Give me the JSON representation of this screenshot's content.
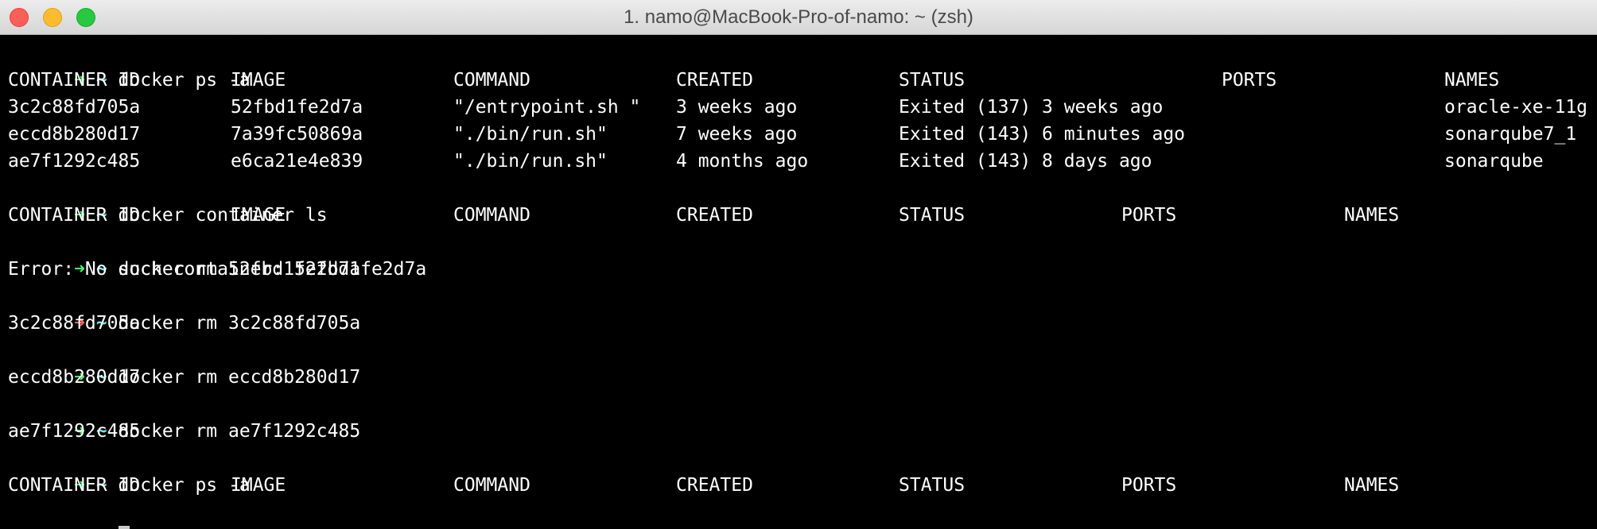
{
  "window": {
    "title": "1. namo@MacBook-Pro-of-namo: ~ (zsh)"
  },
  "prompt": {
    "arrow": "➜",
    "dir": "~"
  },
  "colors": {
    "arrow_ok": "#4ff26c",
    "arrow_error": "#ff5f5f",
    "prompt_dir": "#5ff3f3",
    "text": "#ffffff",
    "background": "#000000"
  },
  "terminal": {
    "cmd1": "docker ps -a",
    "ps1_headers": [
      "CONTAINER ID",
      "IMAGE",
      "COMMAND",
      "CREATED",
      "STATUS",
      "PORTS",
      "NAMES"
    ],
    "ps1_rows": [
      [
        "3c2c88fd705a",
        "52fbd1fe2d7a",
        "\"/entrypoint.sh \"",
        "3 weeks ago",
        "Exited (137) 3 weeks ago",
        "",
        "oracle-xe-11g"
      ],
      [
        "eccd8b280d17",
        "7a39fc50869a",
        "\"./bin/run.sh\"",
        "7 weeks ago",
        "Exited (143) 6 minutes ago",
        "",
        "sonarqube7_1"
      ],
      [
        "ae7f1292c485",
        "e6ca21e4e839",
        "\"./bin/run.sh\"",
        "4 months ago",
        "Exited (143) 8 days ago",
        "",
        "sonarqube"
      ]
    ],
    "cmd2": "docker container ls",
    "ls_headers": [
      "CONTAINER ID",
      "IMAGE",
      "COMMAND",
      "CREATED",
      "STATUS",
      "PORTS",
      "NAMES"
    ],
    "cmd3": "docker rm 52fbd1fe2d7a",
    "out3": "Error: No such container: 52fbd1fe2d7a",
    "cmd4": "docker rm 3c2c88fd705a",
    "out4": "3c2c88fd705a",
    "cmd5": "docker rm eccd8b280d17",
    "out5": "eccd8b280d17",
    "cmd6": "docker rm ae7f1292c485",
    "out6": "ae7f1292c485",
    "cmd7": "docker ps -a",
    "ps2_headers": [
      "CONTAINER ID",
      "IMAGE",
      "COMMAND",
      "CREATED",
      "STATUS",
      "PORTS",
      "NAMES"
    ]
  }
}
